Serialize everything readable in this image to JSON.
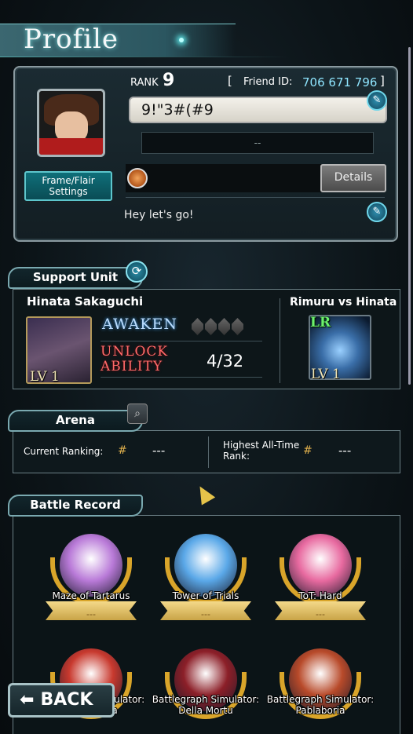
{
  "header": {
    "title": "Profile"
  },
  "profile": {
    "rank_label": "RANK",
    "rank_value": "9",
    "friend_id_open": "[",
    "friend_id_label": "Friend ID:",
    "friend_id_value": "706 671 796",
    "friend_id_close": "]",
    "player_name": "9!\"3#(#9",
    "title_placeholder": "--",
    "frame_flair_label": "Frame/Flair Settings",
    "details_label": "Details",
    "comment": "Hey let's go!"
  },
  "support_unit": {
    "section_label": "Support Unit",
    "unit_name": "Hinata Sakaguchi",
    "unit_level": "LV 1",
    "awaken_label": "AWAKEN",
    "unlock_label_line1": "UNLOCK",
    "unlock_label_line2": "ABILITY",
    "unlock_count": "4/32",
    "equipment_name": "Rimuru vs Hinata",
    "equipment_rarity": "LR",
    "equipment_level": "LV 1"
  },
  "arena": {
    "section_label": "Arena",
    "current_ranking_label": "Current Ranking:",
    "current_ranking_value": "---",
    "highest_rank_label": "Highest All-Time Rank:",
    "highest_rank_value": "---"
  },
  "battle_record": {
    "section_label": "Battle Record",
    "medals": [
      {
        "label": "Maze of Tartarus",
        "value": "---",
        "color": "#b97ad8"
      },
      {
        "label": "Tower of Trials",
        "value": "---",
        "color": "#5aa8e8"
      },
      {
        "label": "ToT: Hard",
        "value": "---",
        "color": "#e86aa0"
      },
      {
        "label": "Battlegraph Simulator: Jalabaringa",
        "value": "",
        "color": "#c8392e"
      },
      {
        "label": "Battlegraph Simulator: Della Mortu",
        "value": "",
        "color": "#8c1f28"
      },
      {
        "label": "Battlegraph Simulator: Pablaboria",
        "value": "",
        "color": "#b84a2a"
      }
    ]
  },
  "navigation": {
    "back_label": "BACK"
  },
  "colors": {
    "accent": "#5dc6cc",
    "friend_id": "#8fe6ff",
    "unlock": "#ff6a6a",
    "gold": "#d9a52a"
  }
}
